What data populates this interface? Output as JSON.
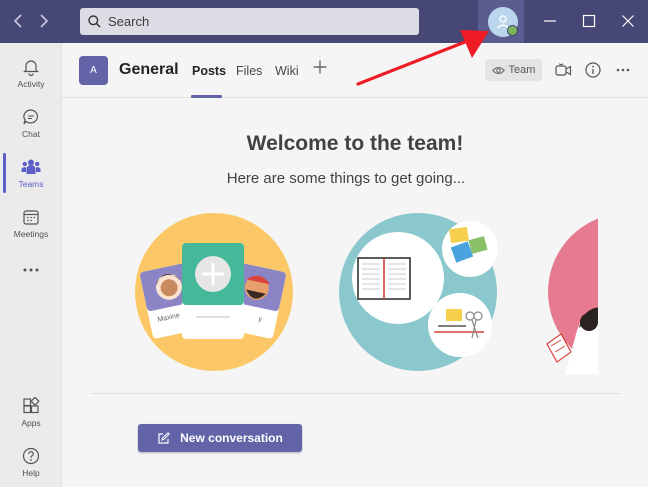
{
  "search": {
    "placeholder": "Search"
  },
  "rail": {
    "items": [
      {
        "label": "Activity"
      },
      {
        "label": "Chat"
      },
      {
        "label": "Teams"
      },
      {
        "label": "Meetings"
      },
      {
        "label": "Apps"
      },
      {
        "label": "Help"
      }
    ]
  },
  "header": {
    "team_initial": "A",
    "channel": "General",
    "tabs": [
      {
        "label": "Posts"
      },
      {
        "label": "Files"
      },
      {
        "label": "Wiki"
      }
    ],
    "team_chip": "Team"
  },
  "main": {
    "title": "Welcome to the team!",
    "subtitle": "Here are some things to get going...",
    "illustration": {
      "name_left": "Maxine",
      "name_right": "y"
    },
    "new_conversation": "New conversation"
  },
  "colors": {
    "titlebar": "#464775",
    "accent": "#6264a7",
    "annotation_arrow": "#ee1c25"
  }
}
